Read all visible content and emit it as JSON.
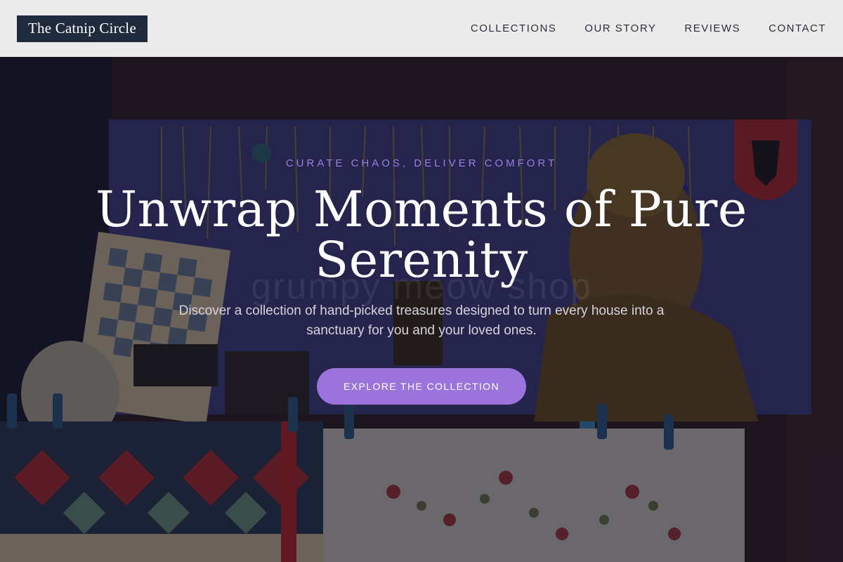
{
  "header": {
    "logo_text": "The Catnip Circle",
    "nav": [
      {
        "label": "COLLECTIONS"
      },
      {
        "label": "OUR STORY"
      },
      {
        "label": "REVIEWS"
      },
      {
        "label": "CONTACT"
      }
    ]
  },
  "hero": {
    "tagline": "CURATE CHAOS, DELIVER COMFORT",
    "headline": "Unwrap Moments of Pure Serenity",
    "subtext": "Discover a collection of hand-picked treasures designed to turn every house into a sanctuary for you and your loved ones.",
    "cta_label": "EXPLORE THE COLLECTION",
    "watermark": "grumpy meow shop"
  },
  "colors": {
    "accent": "#9a74db",
    "tagline": "#9b7fe0",
    "logo_bg": "#1f2a3d",
    "header_bg": "#ebebeb"
  }
}
